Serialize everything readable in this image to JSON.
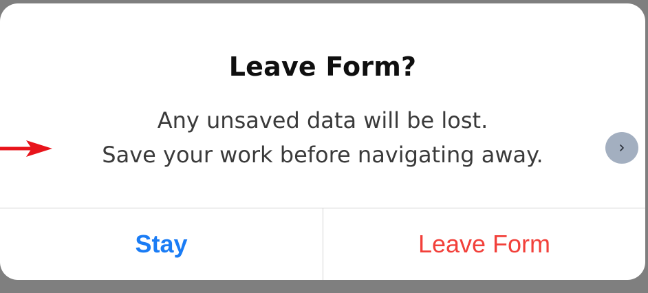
{
  "dialog": {
    "title": "Leave Form?",
    "message_line1": "Any unsaved data will be lost.",
    "message_line2": "Save your work before navigating away.",
    "stay_label": "Stay",
    "leave_label": "Leave Form"
  },
  "icons": {
    "next": "chevron-right-icon",
    "annotation": "red-arrow-icon"
  },
  "colors": {
    "stay": "#1a7cf5",
    "leave": "#f2403a",
    "annotation_arrow": "#e8141b",
    "next_button": "#a3afc0"
  }
}
